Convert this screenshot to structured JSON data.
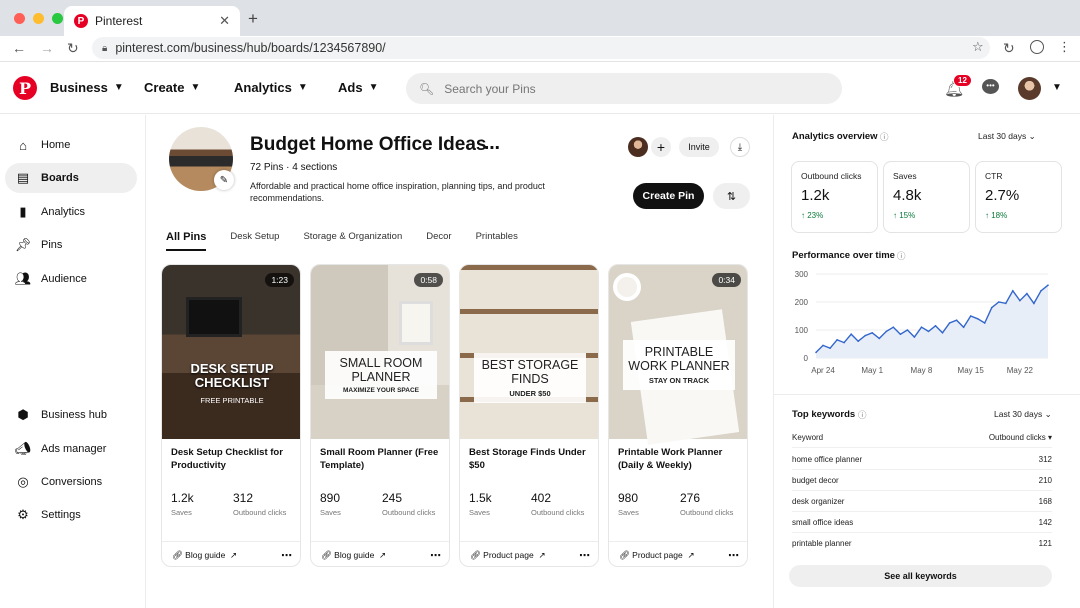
{
  "browser": {
    "tab_title": "Pinterest",
    "url": "pinterest.com/business/hub/boards/1234567890/"
  },
  "header": {
    "nav": [
      {
        "label": "Business"
      },
      {
        "label": "Create"
      },
      {
        "label": "Analytics"
      },
      {
        "label": "Ads"
      }
    ],
    "search_placeholder": "Search your Pins",
    "notification_count": "12",
    "brand_color": "#e60023"
  },
  "sidebar": {
    "top_items": [
      {
        "label": "Home",
        "icon": "home-icon"
      },
      {
        "label": "Boards",
        "icon": "boards-icon"
      },
      {
        "label": "Analytics",
        "icon": "analytics-icon"
      },
      {
        "label": "Pins",
        "icon": "pin-icon"
      },
      {
        "label": "Audience",
        "icon": "audience-icon"
      }
    ],
    "bottom_items": [
      {
        "label": "Business hub",
        "icon": "business-hub-icon"
      },
      {
        "label": "Ads manager",
        "icon": "megaphone-icon"
      },
      {
        "label": "Conversions",
        "icon": "conversions-icon"
      },
      {
        "label": "Settings",
        "icon": "gear-icon"
      }
    ]
  },
  "board": {
    "title": "Budget Home Office Ideas",
    "meta": "72 Pins · 4 sections",
    "description": "Affordable and practical home office inspiration, planning tips, and product recommendations.",
    "invite_label": "Invite",
    "create_pin_label": "Create Pin",
    "tabs": [
      "All Pins",
      "Desk Setup",
      "Storage & Organization",
      "Decor",
      "Printables"
    ]
  },
  "cards": [
    {
      "duration": "1:23",
      "overlay_title": "DESK SETUP CHECKLIST",
      "overlay_sub": "FREE PRINTABLE",
      "title": "Desk Setup Checklist for Productivity",
      "saves": "1.2k",
      "clicks": "312",
      "saves_label": "Saves",
      "clicks_label": "Outbound clicks",
      "link": "Blog guide"
    },
    {
      "duration": "0:58",
      "overlay_title": "SMALL ROOM PLANNER",
      "overlay_sub": "MAXIMIZE YOUR SPACE",
      "title": "Small Room Planner (Free Template)",
      "saves": "890",
      "clicks": "245",
      "saves_label": "Saves",
      "clicks_label": "Outbound clicks",
      "link": "Blog guide"
    },
    {
      "duration": "",
      "overlay_title": "BEST STORAGE FINDS",
      "overlay_sub": "UNDER $50",
      "title": "Best Storage Finds Under $50",
      "saves": "1.5k",
      "clicks": "402",
      "saves_label": "Saves",
      "clicks_label": "Outbound clicks",
      "link": "Product page"
    },
    {
      "duration": "0:34",
      "overlay_title": "PRINTABLE WORK PLANNER",
      "overlay_sub": "STAY ON TRACK",
      "title": "Printable Work Planner (Daily & Weekly)",
      "saves": "980",
      "clicks": "276",
      "saves_label": "Saves",
      "clicks_label": "Outbound clicks",
      "link": "Product page"
    }
  ],
  "analytics": {
    "title": "Analytics overview",
    "range": "Last 30 days",
    "metrics": [
      {
        "label": "Outbound clicks",
        "value": "1.2k",
        "delta": "23%"
      },
      {
        "label": "Saves",
        "value": "4.8k",
        "delta": "15%"
      },
      {
        "label": "CTR",
        "value": "2.7%",
        "delta": "18%"
      }
    ],
    "performance_title": "Performance over time",
    "keywords_title": "Top keywords",
    "keywords_range": "Last 30 days",
    "kw_col1": "Keyword",
    "kw_col2": "Outbound clicks",
    "keywords": [
      {
        "keyword": "home office planner",
        "clicks": "312"
      },
      {
        "keyword": "budget decor",
        "clicks": "210"
      },
      {
        "keyword": "desk organizer",
        "clicks": "168"
      },
      {
        "keyword": "small office ideas",
        "clicks": "142"
      },
      {
        "keyword": "printable planner",
        "clicks": "121"
      }
    ],
    "see_all_label": "See all keywords",
    "positive_color": "#0a7a3b"
  },
  "chart_data": {
    "type": "area",
    "title": "Performance over time",
    "xlabel": "",
    "ylabel": "",
    "x_ticks": [
      "Apr 24",
      "May 1",
      "May 8",
      "May 15",
      "May 22"
    ],
    "y_ticks": [
      0,
      100,
      200,
      300
    ],
    "ylim": [
      0,
      300
    ],
    "x": [
      "Apr 23",
      "Apr 24",
      "Apr 25",
      "Apr 26",
      "Apr 27",
      "Apr 28",
      "Apr 29",
      "Apr 30",
      "May 1",
      "May 2",
      "May 3",
      "May 4",
      "May 5",
      "May 6",
      "May 7",
      "May 8",
      "May 9",
      "May 10",
      "May 11",
      "May 12",
      "May 13",
      "May 14",
      "May 15",
      "May 16",
      "May 17",
      "May 18",
      "May 19",
      "May 20",
      "May 21",
      "May 22",
      "May 23",
      "May 24",
      "May 25",
      "May 26"
    ],
    "values": [
      20,
      45,
      35,
      65,
      55,
      85,
      60,
      80,
      90,
      70,
      95,
      110,
      85,
      100,
      75,
      110,
      95,
      115,
      90,
      125,
      135,
      110,
      150,
      140,
      125,
      180,
      200,
      195,
      240,
      205,
      230,
      195,
      240,
      260
    ],
    "grid": true,
    "line_color": "#3366cc",
    "fill_color": "#e8eef8"
  }
}
